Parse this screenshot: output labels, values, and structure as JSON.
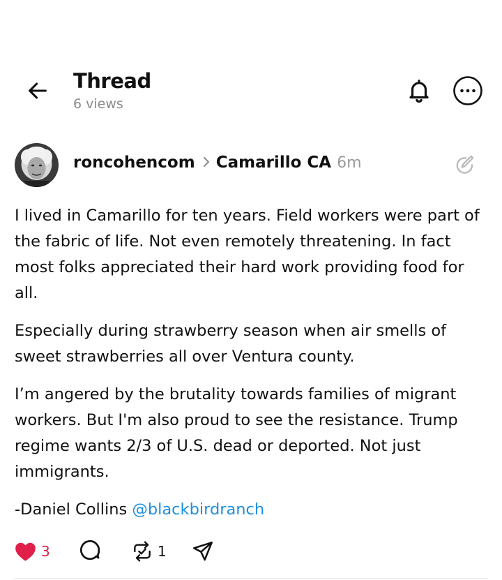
{
  "header": {
    "title": "Thread",
    "views": "6 views"
  },
  "icons": {
    "back": "arrow-left-icon",
    "bell": "bell-icon",
    "more": "more-horizontal-icon",
    "edit": "edit-pencil-icon",
    "like": "heart-icon",
    "reply": "speech-bubble-icon",
    "repost": "repost-icon",
    "share": "send-arrow-icon"
  },
  "post": {
    "author": "roncohencom",
    "community": "Camarillo CA",
    "time": "6m",
    "paragraphs": [
      "I lived in Camarillo for ten years. Field workers were part of the fabric of life. Not even remotely threatening. In fact most folks appreciated their hard work providing food for all.",
      "Especially during strawberry season when air smells of sweet strawberries all over Ventura county.",
      "I’m angered by the brutality towards families of migrant workers. But I'm also proud to see the resistance. Trump regime wants 2/3 of U.S. dead or deported. Not just immigrants."
    ],
    "signature": "-Daniel Collins",
    "mention": "@blackbirdranch"
  },
  "actions": {
    "likes": "3",
    "reposts": "1"
  },
  "colors": {
    "heart": "#e0204a",
    "mention": "#1d8fe1",
    "muted": "#8a8a8a"
  }
}
